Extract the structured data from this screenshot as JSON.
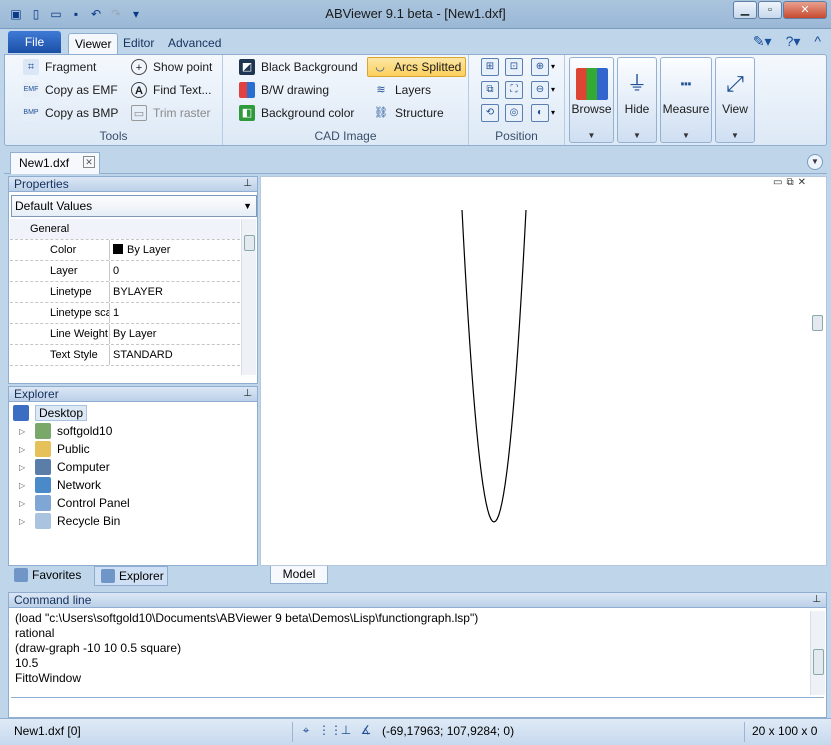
{
  "window": {
    "title": "ABViewer 9.1 beta - [New1.dxf]"
  },
  "ribbon_tabs": {
    "file": "File",
    "viewer": "Viewer",
    "editor": "Editor",
    "advanced": "Advanced"
  },
  "tools_group": {
    "label": "Tools",
    "fragment": "Fragment",
    "show_point": "Show point",
    "copy_emf": "Copy as EMF",
    "find_text": "Find Text...",
    "copy_bmp": "Copy as BMP",
    "trim_raster": "Trim raster"
  },
  "cad_group": {
    "label": "CAD Image",
    "black_bg": "Black Background",
    "arcs_splitted": "Arcs Splitted",
    "bw_drawing": "B/W drawing",
    "layers": "Layers",
    "bg_color": "Background color",
    "structure": "Structure"
  },
  "position_group": {
    "label": "Position"
  },
  "big_buttons": {
    "browse": "Browse",
    "hide": "Hide",
    "measure": "Measure",
    "view": "View"
  },
  "doc_tab": {
    "name": "New1.dxf"
  },
  "properties": {
    "title": "Properties",
    "combo": "Default Values",
    "category": "General",
    "rows": [
      {
        "key": "Color",
        "value": "By Layer"
      },
      {
        "key": "Layer",
        "value": "0"
      },
      {
        "key": "Linetype",
        "value": "BYLAYER"
      },
      {
        "key": "Linetype sca",
        "value": "1"
      },
      {
        "key": "Line Weight",
        "value": "By Layer"
      },
      {
        "key": "Text Style",
        "value": "STANDARD"
      }
    ]
  },
  "explorer": {
    "title": "Explorer",
    "root": "Desktop",
    "items": [
      "softgold10",
      "Public",
      "Computer",
      "Network",
      "Control Panel",
      "Recycle Bin"
    ]
  },
  "bottom_tabs": {
    "favorites": "Favorites",
    "explorer": "Explorer"
  },
  "model_tab": "Model",
  "command_line": {
    "title": "Command line",
    "lines": [
      "(load \"c:\\Users\\softgold10\\Documents\\ABViewer 9 beta\\Demos\\Lisp\\functiongraph.lsp\")",
      "rational",
      "(draw-graph -10 10 0.5 square)",
      "10.5",
      "FittoWindow"
    ]
  },
  "status": {
    "file": "New1.dxf [0]",
    "coords": "(-69,17963; 107,9284; 0)",
    "size": "20 x 100 x 0"
  }
}
